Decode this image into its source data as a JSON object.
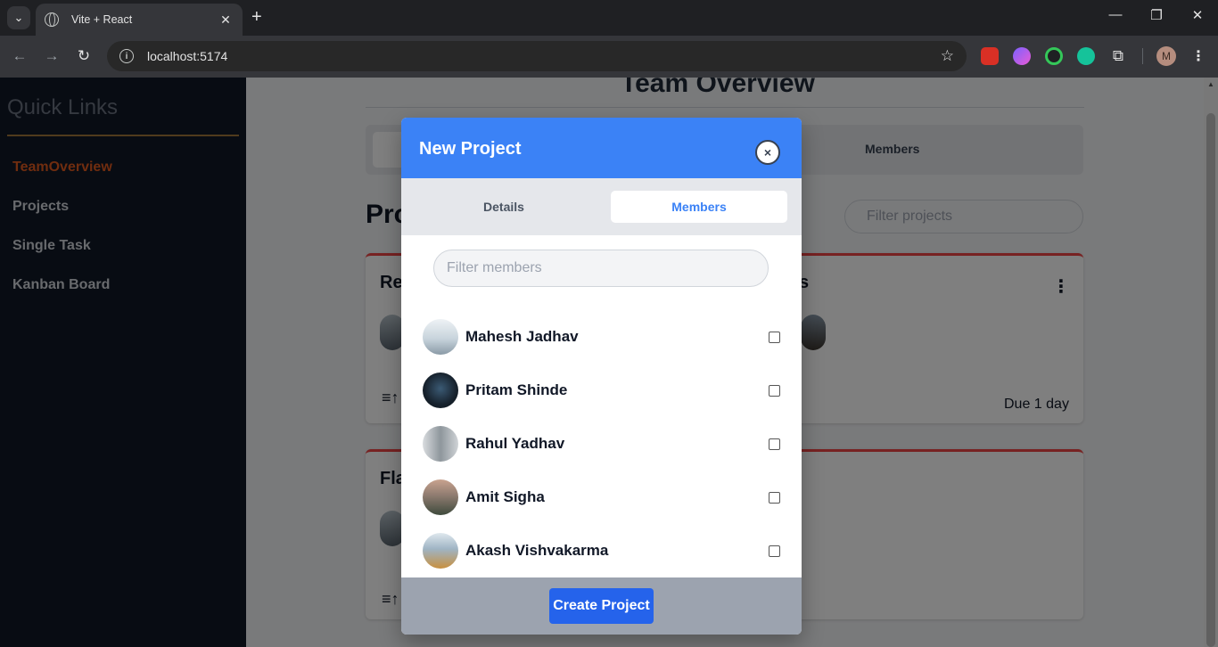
{
  "browser": {
    "tab_title": "Vite + React",
    "url": "localhost:5174",
    "profile_initial": "M"
  },
  "sidebar": {
    "title": "Quick Links",
    "links": [
      "TeamOverview",
      "Projects",
      "Single Task",
      "Kanban Board"
    ],
    "active_link": "TeamOverview"
  },
  "main": {
    "heading": "Team Overview",
    "tabs": {
      "members_label": "Members"
    },
    "projects_heading": "Pro",
    "filter_projects_placeholder": "Filter projects",
    "card1": {
      "title_partial": "Re",
      "title2_partial": "s",
      "due": "Due 1 day"
    },
    "card2": {
      "title_partial": "Fla"
    }
  },
  "modal": {
    "title": "New Project",
    "close_glyph": "×",
    "tab_details": "Details",
    "tab_members": "Members",
    "filter_placeholder": "Filter members",
    "members": [
      {
        "name": "Mahesh Jadhav",
        "checked": false
      },
      {
        "name": "Pritam Shinde",
        "checked": false
      },
      {
        "name": "Rahul Yadhav",
        "checked": false
      },
      {
        "name": "Amit Sigha",
        "checked": false
      },
      {
        "name": "Akash Vishvakarma",
        "checked": false
      }
    ],
    "create_button": "Create Project"
  },
  "colors": {
    "modal_header": "#3b82f6",
    "active_tab_text": "#3b82f6",
    "sidebar_active": "#e05a1f",
    "card_accent": "#ef4444",
    "create_button": "#2563eb"
  }
}
